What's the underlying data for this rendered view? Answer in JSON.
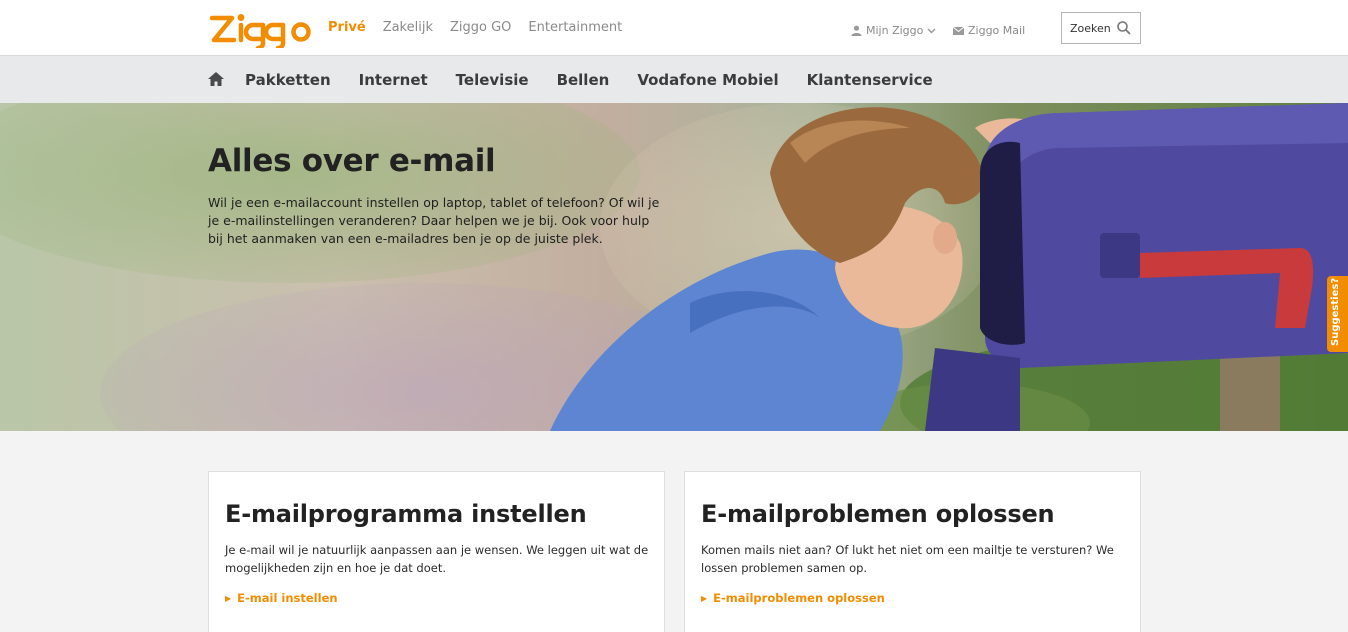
{
  "brand": {
    "name": "ziggo",
    "color": "#f28c00"
  },
  "topnav": [
    {
      "label": "Privé",
      "active": true
    },
    {
      "label": "Zakelijk",
      "active": false
    },
    {
      "label": "Ziggo GO",
      "active": false
    },
    {
      "label": "Entertainment",
      "active": false
    }
  ],
  "utility": {
    "mijn_ziggo": "Mijn Ziggo",
    "ziggo_mail": "Ziggo Mail"
  },
  "search": {
    "placeholder": "Zoeken"
  },
  "mainnav": [
    "Pakketten",
    "Internet",
    "Televisie",
    "Bellen",
    "Vodafone Mobiel",
    "Klantenservice"
  ],
  "hero": {
    "title": "Alles over e-mail",
    "text": "Wil je een e-mailaccount instellen op laptop, tablet of telefoon? Of wil je je e-mailinstellingen veranderen? Daar helpen we je bij. Ook voor hulp bij het aanmaken van een e-mailadres ben je op de juiste plek."
  },
  "suggesties": "Suggesties?",
  "cards": [
    {
      "title": "E-mailprogramma instellen",
      "text": "Je e-mail wil je natuurlijk aanpassen aan je wensen. We leggen uit wat de mogelijkheden zijn en hoe je dat doet.",
      "link": "E-mail instellen"
    },
    {
      "title": "E-mailproblemen oplossen",
      "text": "Komen mails niet aan? Of lukt het niet om een mailtje te versturen? We lossen problemen samen op.",
      "link": "E-mailproblemen oplossen"
    }
  ]
}
